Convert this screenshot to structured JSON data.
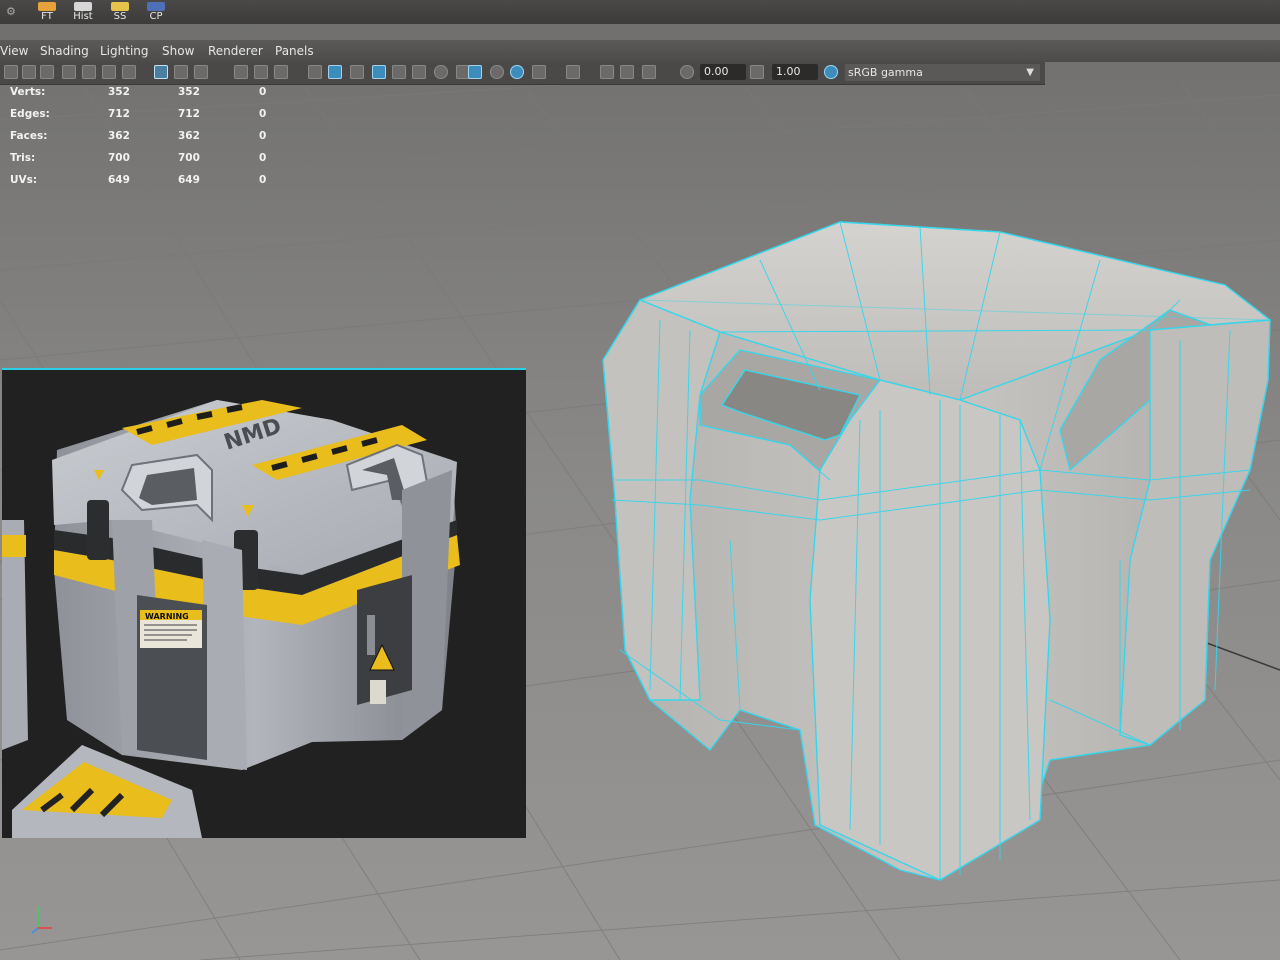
{
  "shelf": {
    "buttons": [
      {
        "label": "FT",
        "color": "#e8a23a"
      },
      {
        "label": "Hist",
        "color": "#d7d7d7"
      },
      {
        "label": "SS",
        "color": "#e7c34a"
      },
      {
        "label": "CP",
        "color": "#4f6fb8"
      }
    ]
  },
  "menubar": {
    "items": [
      "View",
      "Shading",
      "Lighting",
      "Show",
      "Renderer",
      "Panels"
    ]
  },
  "toolbar": {
    "exposure_value": "0.00",
    "gamma_value": "1.00",
    "color_space": "sRGB gamma"
  },
  "hud": {
    "rows": [
      {
        "label": "Verts:",
        "v1": "352",
        "v2": "352",
        "v3": "0"
      },
      {
        "label": "Edges:",
        "v1": "712",
        "v2": "712",
        "v3": "0"
      },
      {
        "label": "Faces:",
        "v1": "362",
        "v2": "362",
        "v3": "0"
      },
      {
        "label": "Tris:",
        "v1": "700",
        "v2": "700",
        "v3": "0"
      },
      {
        "label": "UVs:",
        "v1": "649",
        "v2": "649",
        "v3": "0"
      }
    ]
  },
  "reference": {
    "decal_text": "WARNING",
    "lid_text": "NMD"
  },
  "colors": {
    "wireframe": "#35d6ec",
    "viewport_bg": "#8d8b89",
    "crate_body": "#b8bcc2",
    "stripe": "#f0c419"
  }
}
